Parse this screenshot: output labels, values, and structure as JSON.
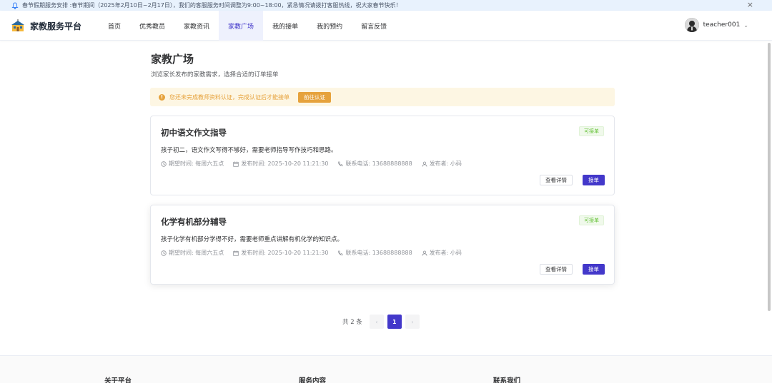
{
  "notice": {
    "text": "春节假期服务安排 :春节期间（2025年2月10日~2月17日），我们的客服服务时间调整为9:00~18:00，紧急情况请拨打客服热线，祝大家春节快乐！",
    "close": "×"
  },
  "header": {
    "brand": "家教服务平台",
    "nav": [
      "首页",
      "优秀教员",
      "家教资讯",
      "家教广场",
      "我的接单",
      "我的预约",
      "留言反馈"
    ],
    "active_nav": "家教广场",
    "username": "teacher001",
    "caret": "⌄"
  },
  "main": {
    "title": "家教广场",
    "subtitle": "浏览家长发布的家教需求，选择合适的订单接单",
    "alert": {
      "text": "您还未完成教师资料认证，完成认证后才能接单",
      "button": "前往认证"
    },
    "cards": [
      {
        "title": "初中语文作文指导",
        "tag": "可接单",
        "desc": "孩子初二，语文作文写得不够好，需要老师指导写作技巧和思路。",
        "expected": "期望时间: 每周六五点",
        "published": "发布时间: 2025-10-20 11:21:30",
        "phone": "联系电话: 13688888888",
        "publisher": "发布者: 小码",
        "detail_btn": "查看详情",
        "take_btn": "接单"
      },
      {
        "title": "化学有机部分辅导",
        "tag": "可接单",
        "desc": "孩子化学有机部分学得不好，需要老师重点讲解有机化学的知识点。",
        "expected": "期望时间: 每周六五点",
        "published": "发布时间: 2025-10-20 11:21:30",
        "phone": "联系电话: 13688888888",
        "publisher": "发布者: 小码",
        "detail_btn": "查看详情",
        "take_btn": "接单"
      }
    ],
    "pagination": {
      "total": "共 2 条",
      "prev": "‹",
      "current": "1",
      "next": "›"
    }
  },
  "footer": {
    "col1": "关于平台",
    "col2": "服务内容",
    "col3": "联系我们"
  },
  "colors": {
    "accent": "#4338ca",
    "warning": "#e6a23c",
    "success": "#67c23a",
    "notice_bg": "#e8f2fd"
  }
}
